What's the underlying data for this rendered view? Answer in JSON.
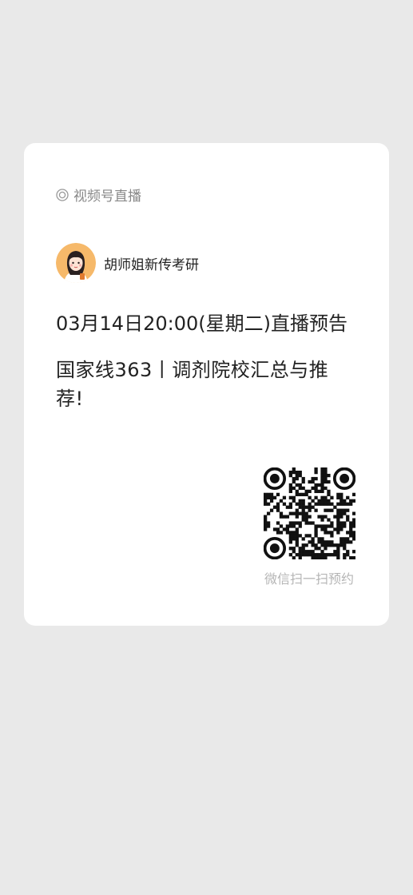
{
  "card": {
    "source_label": "视频号直播",
    "author_name": "胡师姐新传考研",
    "date_line": "03月14日20:00(星期二)直播预告",
    "title": "国家线363丨调剂院校汇总与推荐!",
    "qr_caption": "微信扫一扫预约"
  },
  "icons": {
    "source": "live-ring-icon",
    "avatar": "avatar-illustration",
    "qr": "qr-code"
  },
  "colors": {
    "background": "#e9e9e9",
    "card": "#ffffff",
    "primary_text": "#222222",
    "secondary_text": "#888888",
    "caption_text": "#b5b5b5"
  }
}
